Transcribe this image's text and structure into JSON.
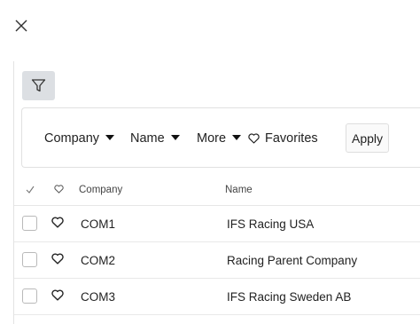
{
  "toolbar": {
    "close_icon": "close-icon",
    "filter_icon": "filter-funnel-icon"
  },
  "filters": {
    "company_label": "Company",
    "name_label": "Name",
    "more_label": "More",
    "favorites_label": "Favorites",
    "apply_label": "Apply"
  },
  "grid": {
    "columns": {
      "select_icon": "check-icon",
      "favorite_icon": "heart-icon",
      "company": "Company",
      "name": "Name"
    },
    "rows": [
      {
        "company": "COM1",
        "name": "IFS Racing USA"
      },
      {
        "company": "COM2",
        "name": "Racing Parent Company"
      },
      {
        "company": "COM3",
        "name": "IFS Racing Sweden AB"
      }
    ]
  },
  "colors": {
    "filter_toggle_bg": "#dcdfe3",
    "border": "#e1e1e1"
  }
}
